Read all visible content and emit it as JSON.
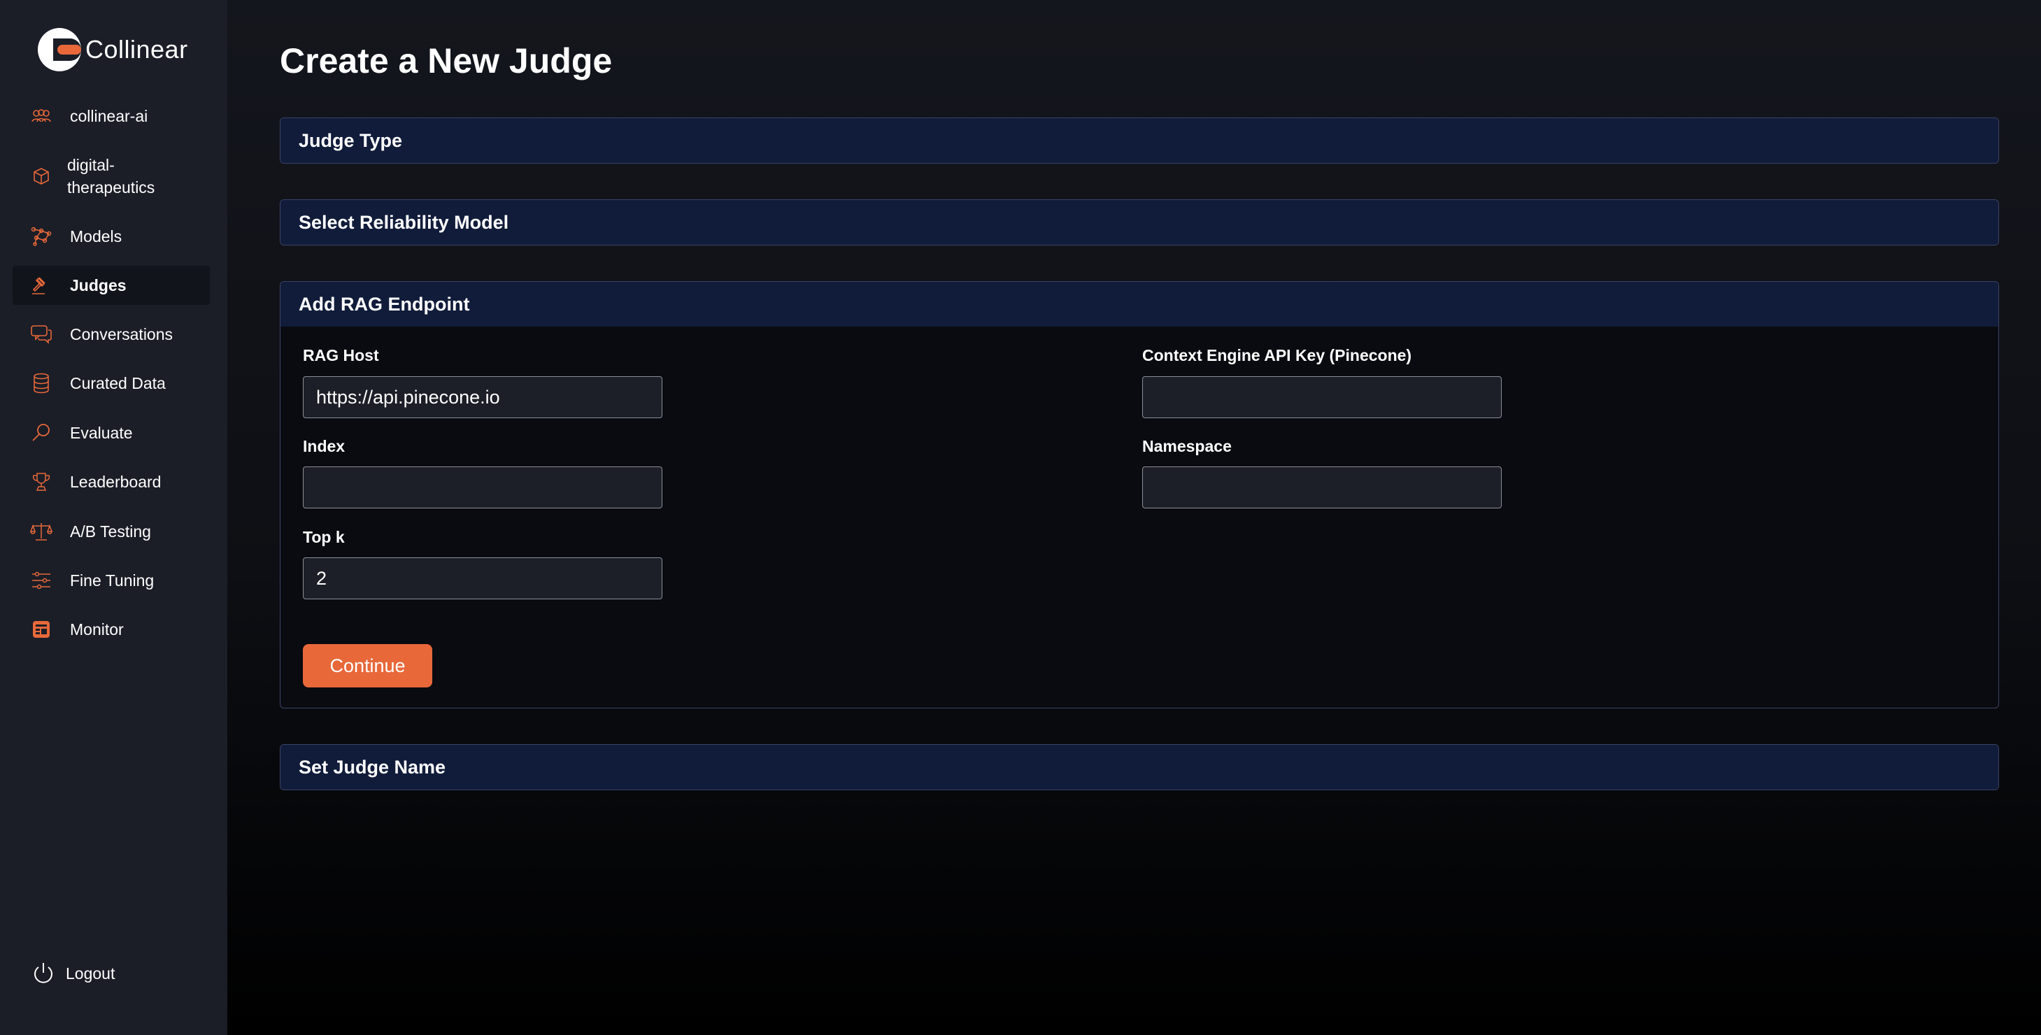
{
  "brand": {
    "name": "Collinear",
    "accent": "#e8683a"
  },
  "sidebar": {
    "items": [
      {
        "label": "collinear-ai",
        "icon": "team-icon"
      },
      {
        "label": "digital-\ntherapeutics",
        "icon": "cube-icon"
      },
      {
        "label": "Models",
        "icon": "network-icon"
      },
      {
        "label": "Judges",
        "icon": "gavel-icon",
        "active": true
      },
      {
        "label": "Conversations",
        "icon": "chat-icon"
      },
      {
        "label": "Curated Data",
        "icon": "database-icon"
      },
      {
        "label": "Evaluate",
        "icon": "search-icon"
      },
      {
        "label": "Leaderboard",
        "icon": "trophy-icon"
      },
      {
        "label": "A/B Testing",
        "icon": "scale-icon"
      },
      {
        "label": "Fine Tuning",
        "icon": "sliders-icon"
      },
      {
        "label": "Monitor",
        "icon": "monitor-icon"
      }
    ],
    "logout_label": "Logout"
  },
  "main": {
    "title": "Create a New Judge",
    "sections": {
      "judge_type": "Judge Type",
      "reliability_model": "Select Reliability Model",
      "rag_endpoint": "Add RAG Endpoint",
      "judge_name": "Set Judge Name"
    },
    "rag_form": {
      "rag_host": {
        "label": "RAG Host",
        "value": "https://api.pinecone.io"
      },
      "api_key": {
        "label": "Context Engine API Key (Pinecone)",
        "value": ""
      },
      "index": {
        "label": "Index",
        "value": ""
      },
      "namespace": {
        "label": "Namespace",
        "value": ""
      },
      "top_k": {
        "label": "Top k",
        "value": "2"
      },
      "continue_label": "Continue"
    }
  }
}
